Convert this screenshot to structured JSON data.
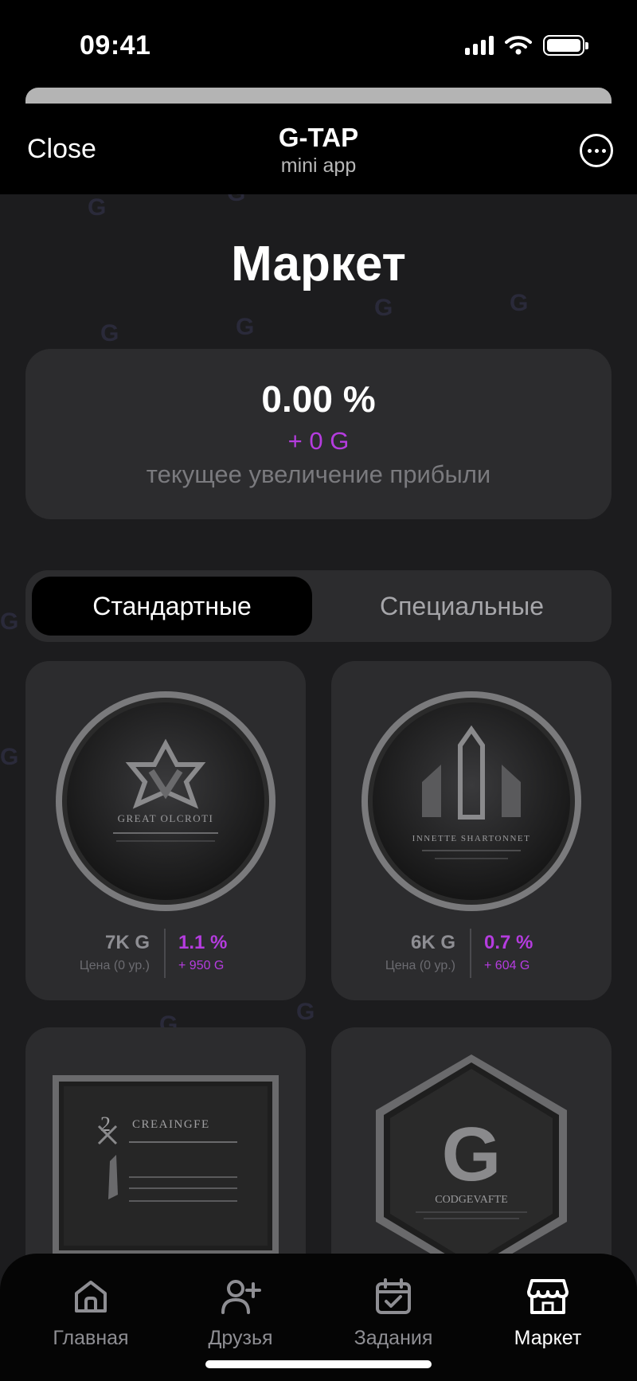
{
  "status_bar": {
    "time": "09:41"
  },
  "header": {
    "close_label": "Close",
    "title": "G-TAP",
    "subtitle": "mini app"
  },
  "page": {
    "title": "Маркет"
  },
  "profit": {
    "percent": "0.00 %",
    "gain": "+ 0 G",
    "label": "текущее увеличение прибыли"
  },
  "tabs": [
    {
      "label": "Стандартные",
      "active": true
    },
    {
      "label": "Специальные",
      "active": false
    }
  ],
  "cards": [
    {
      "price": "7K G",
      "price_label": "Цена (0 ур.)",
      "percent": "1.1 %",
      "gain": "+ 950 G",
      "image_text": "GREAT OLCROTI"
    },
    {
      "price": "6K G",
      "price_label": "Цена (0 ур.)",
      "percent": "0.7 %",
      "gain": "+ 604 G",
      "image_text": "INNETTE SHARTONNET"
    },
    {
      "image_text": "CREAINGFE"
    },
    {
      "image_text": "CODGEVAFTE"
    }
  ],
  "nav": [
    {
      "label": "Главная",
      "icon": "home-icon",
      "active": false
    },
    {
      "label": "Друзья",
      "icon": "add-friend-icon",
      "active": false
    },
    {
      "label": "Задания",
      "icon": "calendar-check-icon",
      "active": false
    },
    {
      "label": "Маркет",
      "icon": "store-icon",
      "active": true
    }
  ],
  "colors": {
    "accent": "#b53cdf",
    "card_bg": "#2c2c2e",
    "page_bg": "#1c1c1e"
  }
}
